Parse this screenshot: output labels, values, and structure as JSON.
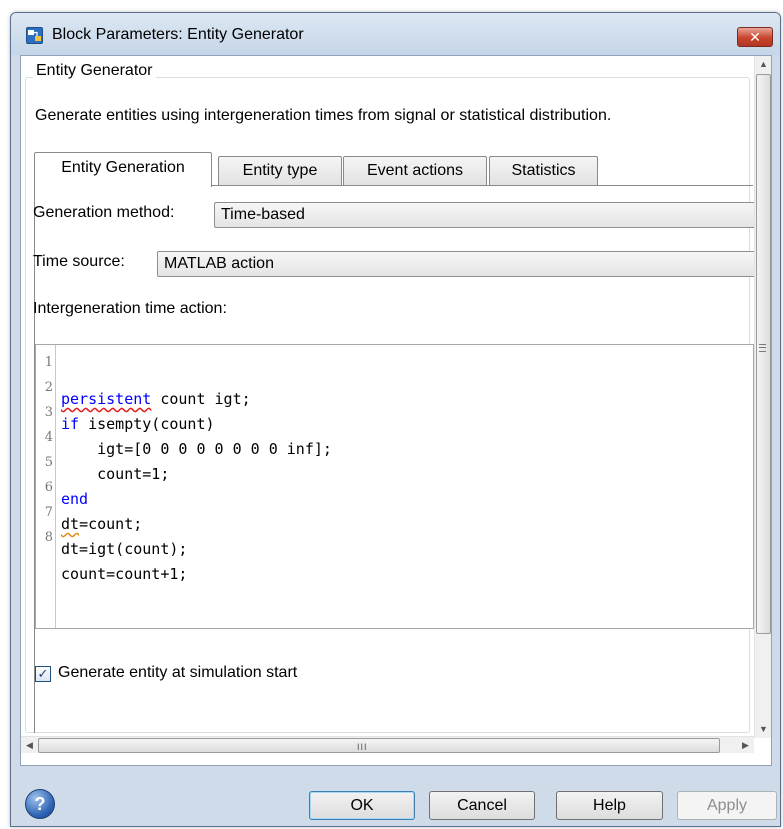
{
  "window": {
    "title": "Block Parameters: Entity Generator",
    "close_glyph": "✕"
  },
  "block": {
    "group_title": "Entity Generator",
    "description": "Generate entities using intergeneration times from signal or statistical distribution."
  },
  "tabs": [
    {
      "label": "Entity Generation",
      "active": true
    },
    {
      "label": "Entity type",
      "active": false
    },
    {
      "label": "Event actions",
      "active": false
    },
    {
      "label": "Statistics",
      "active": false
    }
  ],
  "fields": {
    "generation_method": {
      "label": "Generation method:",
      "value": "Time-based"
    },
    "time_source": {
      "label": "Time source:",
      "value": "MATLAB action"
    },
    "intergeneration_label": "Intergeneration time action:"
  },
  "code_lines": [
    {
      "number": "1",
      "text": "persistent count igt;"
    },
    {
      "number": "2",
      "text": "if isempty(count)"
    },
    {
      "number": "3",
      "text": "    igt=[0 0 0 0 0 0 0 0 inf];"
    },
    {
      "number": "4",
      "text": "    count=1;"
    },
    {
      "number": "5",
      "text": "end"
    },
    {
      "number": "6",
      "text": "dt=count;"
    },
    {
      "number": "7",
      "text": "dt=igt(count);"
    },
    {
      "number": "8",
      "text": "count=count+1;"
    }
  ],
  "checkbox": {
    "label": "Generate entity at simulation start",
    "checked": true
  },
  "buttons": {
    "ok": "OK",
    "cancel": "Cancel",
    "help": "Help",
    "apply": "Apply"
  },
  "scroll": {
    "h_grip": "III"
  },
  "colors": {
    "keyword": "#0000ff",
    "spell_error": "#e01c1c"
  },
  "icons": {
    "app": "simulink-block-icon",
    "help": "help-question-icon"
  }
}
